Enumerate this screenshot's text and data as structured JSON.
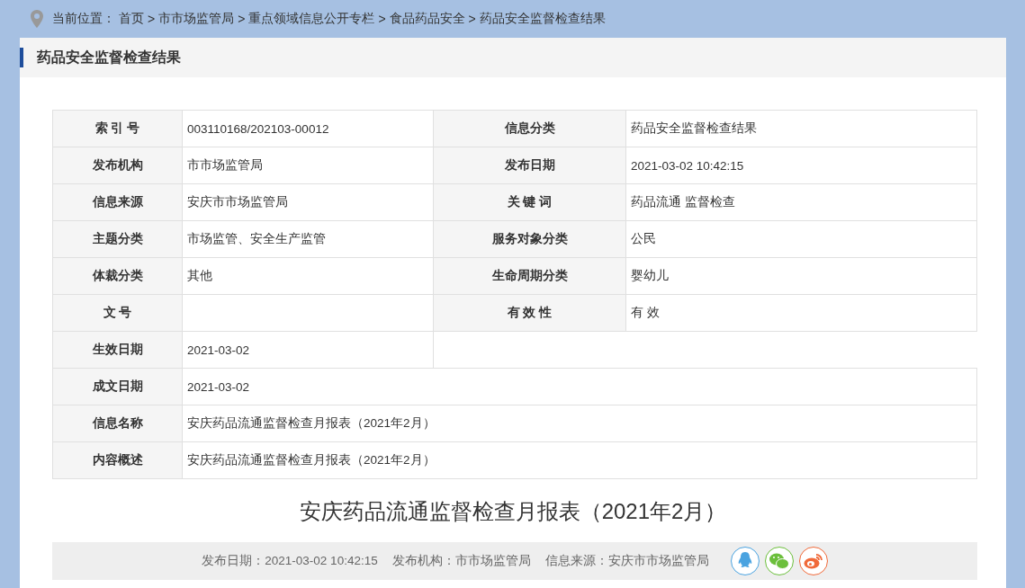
{
  "breadcrumb": {
    "label": "当前位置：",
    "items": [
      "首页",
      "市市场监管局",
      "重点领域信息公开专栏",
      "食品药品安全",
      "药品安全监督检查结果"
    ],
    "separator": ">"
  },
  "section_title": "药品安全监督检查结果",
  "info_table": {
    "rows": [
      {
        "kind": "pair",
        "cells": [
          {
            "label": "索 引 号",
            "value": "003110168/202103-00012"
          },
          {
            "label": "信息分类",
            "value": "药品安全监督检查结果"
          }
        ]
      },
      {
        "kind": "pair",
        "cells": [
          {
            "label": "发布机构",
            "value": "市市场监管局"
          },
          {
            "label": "发布日期",
            "value": "2021-03-02 10:42:15"
          }
        ]
      },
      {
        "kind": "pair",
        "cells": [
          {
            "label": "信息来源",
            "value": "安庆市市场监管局"
          },
          {
            "label": "关 键 词",
            "value": "药品流通 监督检查"
          }
        ]
      },
      {
        "kind": "pair",
        "cells": [
          {
            "label": "主题分类",
            "value": "市场监管、安全生产监管"
          },
          {
            "label": "服务对象分类",
            "value": "公民"
          }
        ]
      },
      {
        "kind": "pair",
        "cells": [
          {
            "label": "体裁分类",
            "value": "其他"
          },
          {
            "label": "生命周期分类",
            "value": "婴幼儿"
          }
        ]
      },
      {
        "kind": "pair",
        "cells": [
          {
            "label": "文 号"
          },
          {
            "label": "有 效 性",
            "value": "有 效"
          }
        ]
      },
      {
        "kind": "half",
        "cells": [
          {
            "label": "生效日期",
            "value": "2021-03-02"
          }
        ]
      },
      {
        "kind": "wide",
        "cells": [
          {
            "label": "成文日期",
            "value": "2021-03-02"
          }
        ]
      },
      {
        "kind": "wide",
        "cells": [
          {
            "label": "信息名称",
            "value": "安庆药品流通监督检查月报表（2021年2月）"
          }
        ]
      },
      {
        "kind": "wide",
        "cells": [
          {
            "label": "内容概述",
            "value": "安庆药品流通监督检查月报表（2021年2月）"
          }
        ]
      }
    ]
  },
  "article_title": "安庆药品流通监督检查月报表（2021年2月）",
  "meta": [
    "发布日期：2021-03-02 10:42:15",
    "发布机构：市市场监管局",
    "信息来源：安庆市市场监管局"
  ],
  "share": [
    {
      "kind": "qq",
      "color": "#4aa3e0"
    },
    {
      "kind": "wechat",
      "color": "#6cbf3c"
    },
    {
      "kind": "weibo",
      "color": "#f06a3a"
    }
  ]
}
